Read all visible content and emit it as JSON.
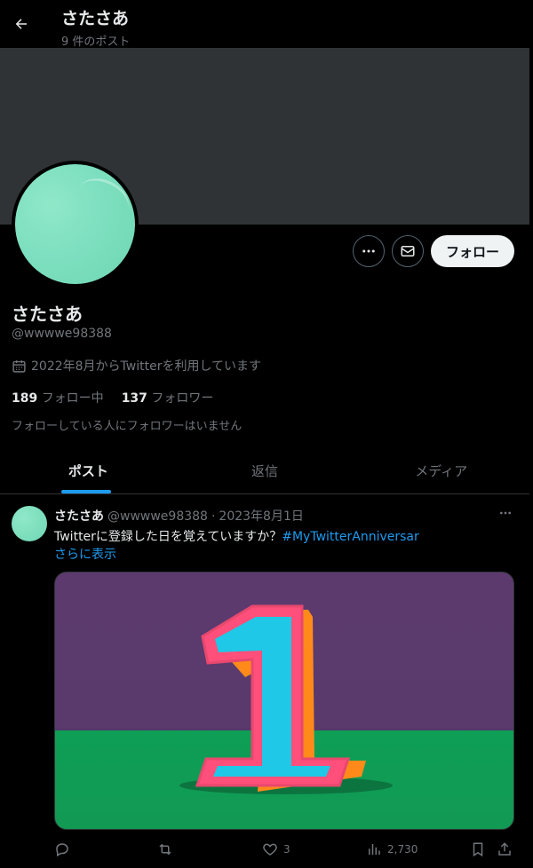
{
  "header": {
    "display_name": "さたさあ",
    "post_count": "9 件のポスト"
  },
  "profile": {
    "name": "さたさあ",
    "handle": "@wwwwe98388",
    "joined": "2022年8月からTwitterを利用しています",
    "following_count": "189",
    "following_label": "フォロー中",
    "followers_count": "137",
    "followers_label": "フォロワー",
    "mutual_note": "フォローしている人にフォロワーはいません",
    "follow_label": "フォロー",
    "avatar_color": "#7ddfbf",
    "banner_color": "#2f3336"
  },
  "tabs": [
    {
      "label": "ポスト",
      "active": true
    },
    {
      "label": "返信",
      "active": false
    },
    {
      "label": "メディア",
      "active": false
    }
  ],
  "post": {
    "name": "さたさあ",
    "handle": "@wwwwe98388",
    "separator": "·",
    "date": "2023年8月1日",
    "text": "Twitterに登録した日を覚えていますか？",
    "hashtag": "#MyTwitterAnniversar",
    "show_more": "さらに表示",
    "likes": "3",
    "views": "2,730"
  },
  "colors": {
    "accent": "#1d9bf0",
    "muted": "#71767b",
    "background": "#000000"
  },
  "icons": {
    "back": "arrow-left-icon",
    "more": "more-icon",
    "message": "mail-icon",
    "calendar": "calendar-icon",
    "reply": "reply-icon",
    "repost": "repost-icon",
    "like": "heart-icon",
    "views": "views-icon",
    "bookmark": "bookmark-icon",
    "share": "share-icon"
  }
}
